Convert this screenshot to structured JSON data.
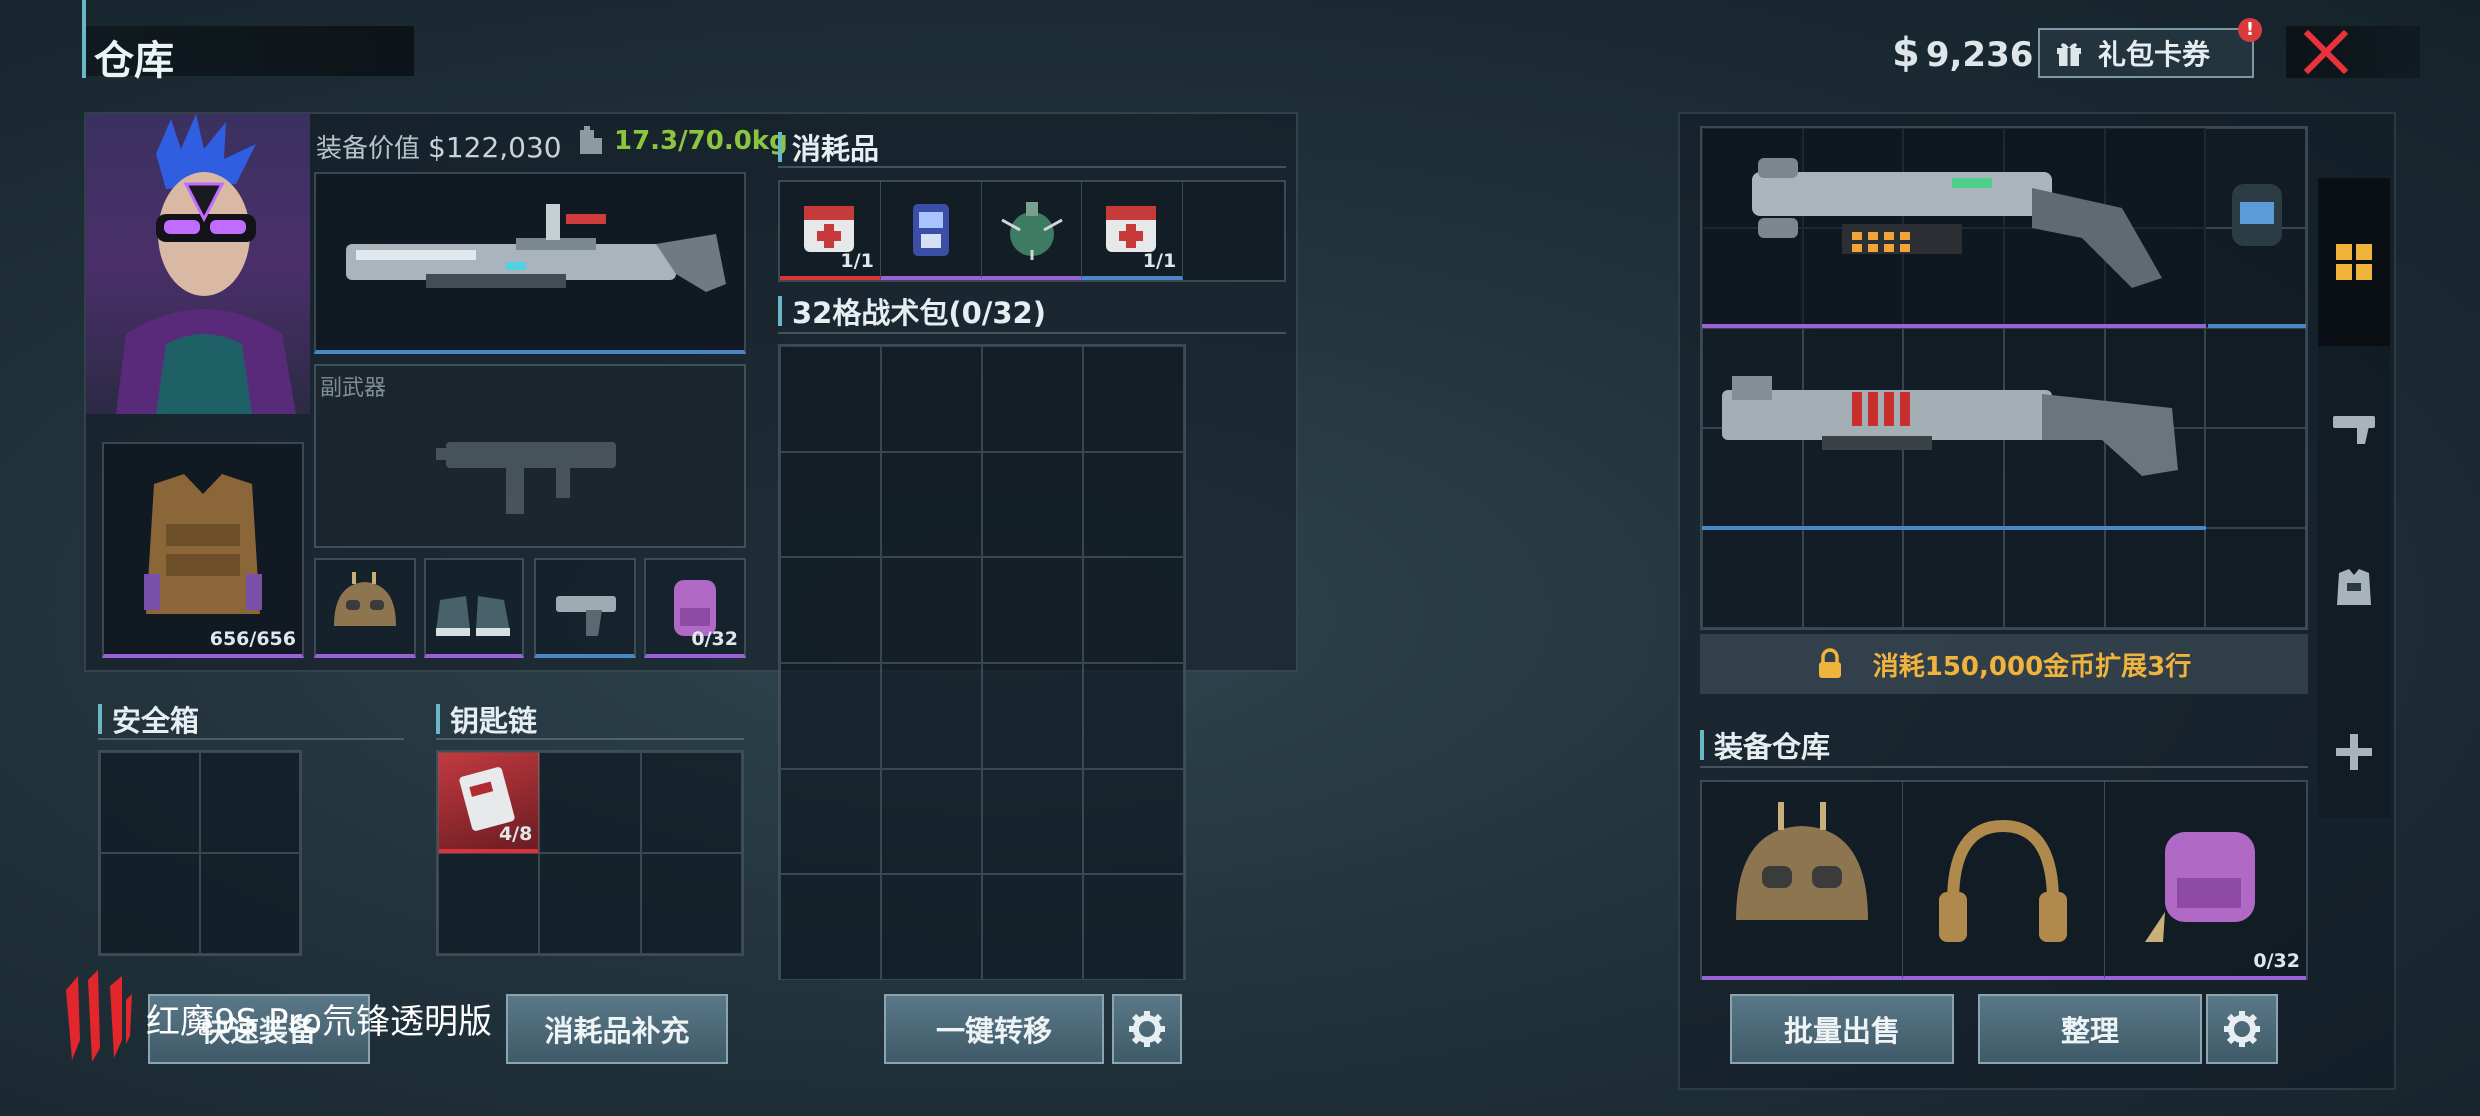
{
  "header": {
    "title": "仓库",
    "currency_symbol": "$",
    "currency": "9,236",
    "gift_label": "礼包卡券",
    "gift_badge": "!"
  },
  "loadout": {
    "value_label": "装备价值",
    "value": "$122,030",
    "weight": "17.3/70.0kg",
    "secondary_label": "副武器",
    "armor_durability": "656/656",
    "backpack_capacity": "0/32"
  },
  "consumables": {
    "title": "消耗品",
    "items": [
      {
        "icon": "medkit-icon",
        "count": "1/1",
        "rarity": "red"
      },
      {
        "icon": "stim-icon",
        "count": "",
        "rarity": "purple"
      },
      {
        "icon": "grenade-icon",
        "count": "",
        "rarity": "purple"
      },
      {
        "icon": "medkit-icon",
        "count": "1/1",
        "rarity": "blue"
      }
    ]
  },
  "tactical_bag": {
    "title": "32格战术包(0/32)"
  },
  "safe_box": {
    "title": "安全箱"
  },
  "keychain": {
    "title": "钥匙链",
    "key_count": "4/8"
  },
  "storage": {
    "expand_label": "消耗150,000金币扩展3行"
  },
  "equipment_storage": {
    "title": "装备仓库",
    "backpack_capacity": "0/32"
  },
  "buttons": {
    "quick_equip": "快速装备",
    "refill": "消耗品补充",
    "transfer": "一键转移",
    "bulk_sell": "批量出售",
    "organize": "整理"
  },
  "watermark": {
    "text": "红魔9S Pro氘锋透明版"
  },
  "colors": {
    "accent": "#6ab8c5",
    "weight_green": "#8cc63f",
    "expand_gold": "#f0b43c",
    "close_red": "#e8333a",
    "rarity_purple": "#9a62d8",
    "rarity_blue": "#4b86c8"
  }
}
